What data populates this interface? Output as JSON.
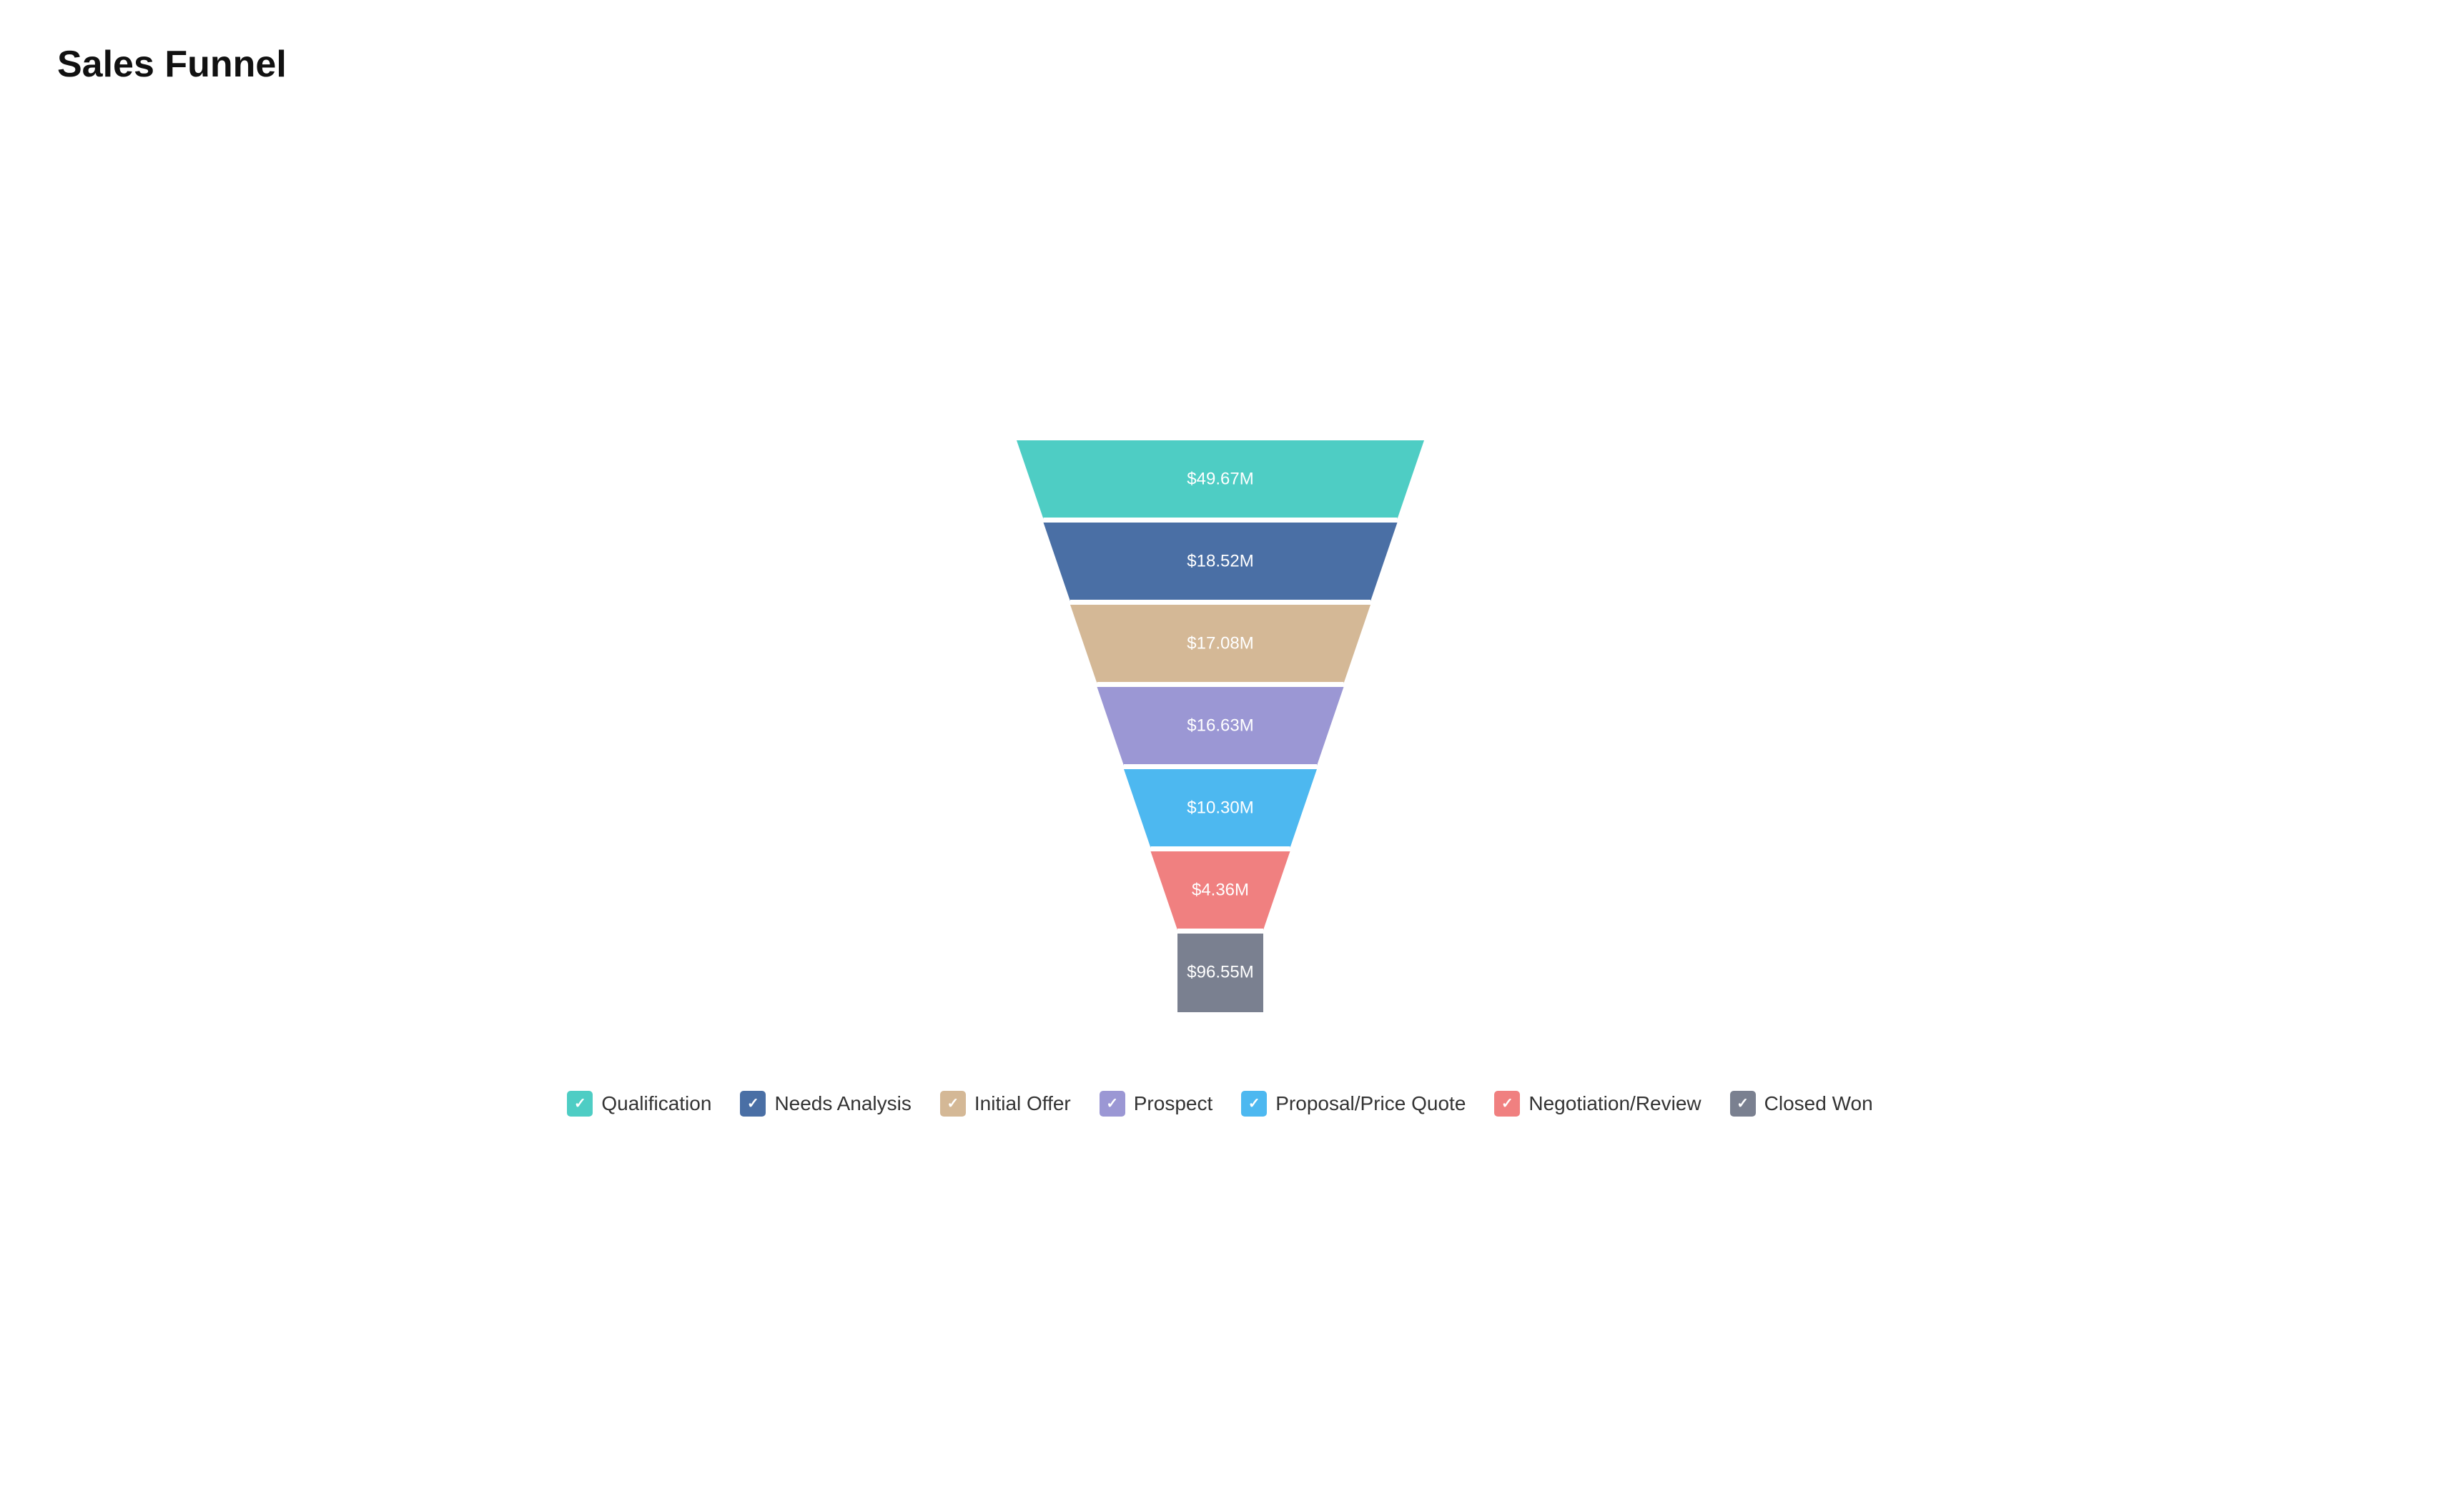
{
  "title": "Sales Funnel",
  "funnel": {
    "segments": [
      {
        "id": "qualification",
        "label": "$49.67M",
        "color": "#4ecdc4",
        "topWidth": 570,
        "bottomWidth": 495,
        "height": 110,
        "yOffset": 0
      },
      {
        "id": "needs-analysis",
        "label": "$18.52M",
        "color": "#4a6fa5",
        "topWidth": 495,
        "bottomWidth": 420,
        "height": 110,
        "yOffset": 115
      },
      {
        "id": "initial-offer",
        "label": "$17.08M",
        "color": "#d4b896",
        "topWidth": 420,
        "bottomWidth": 345,
        "height": 110,
        "yOffset": 230
      },
      {
        "id": "prospect",
        "label": "$16.63M",
        "color": "#9b97d4",
        "topWidth": 345,
        "bottomWidth": 270,
        "height": 110,
        "yOffset": 345
      },
      {
        "id": "proposal-price-quote",
        "label": "$10.30M",
        "color": "#4db8f0",
        "topWidth": 270,
        "bottomWidth": 195,
        "height": 110,
        "yOffset": 460
      },
      {
        "id": "negotiation-review",
        "label": "$4.36M",
        "color": "#f08080",
        "topWidth": 195,
        "bottomWidth": 120,
        "height": 110,
        "yOffset": 575
      },
      {
        "id": "closed-won",
        "label": "$96.55M",
        "color": "#7a8090",
        "topWidth": 120,
        "bottomWidth": 120,
        "height": 110,
        "yOffset": 690
      }
    ]
  },
  "legend": {
    "items": [
      {
        "id": "qualification",
        "label": "Qualification",
        "color": "#4ecdc4"
      },
      {
        "id": "needs-analysis",
        "label": "Needs Analysis",
        "color": "#4a6fa5"
      },
      {
        "id": "initial-offer",
        "label": "Initial Offer",
        "color": "#d4b896"
      },
      {
        "id": "prospect",
        "label": "Prospect",
        "color": "#9b97d4"
      },
      {
        "id": "proposal-price-quote",
        "label": "Proposal/Price Quote",
        "color": "#4db8f0"
      },
      {
        "id": "negotiation-review",
        "label": "Negotiation/Review",
        "color": "#f08080"
      },
      {
        "id": "closed-won",
        "label": "Closed Won",
        "color": "#7a8090"
      }
    ]
  }
}
